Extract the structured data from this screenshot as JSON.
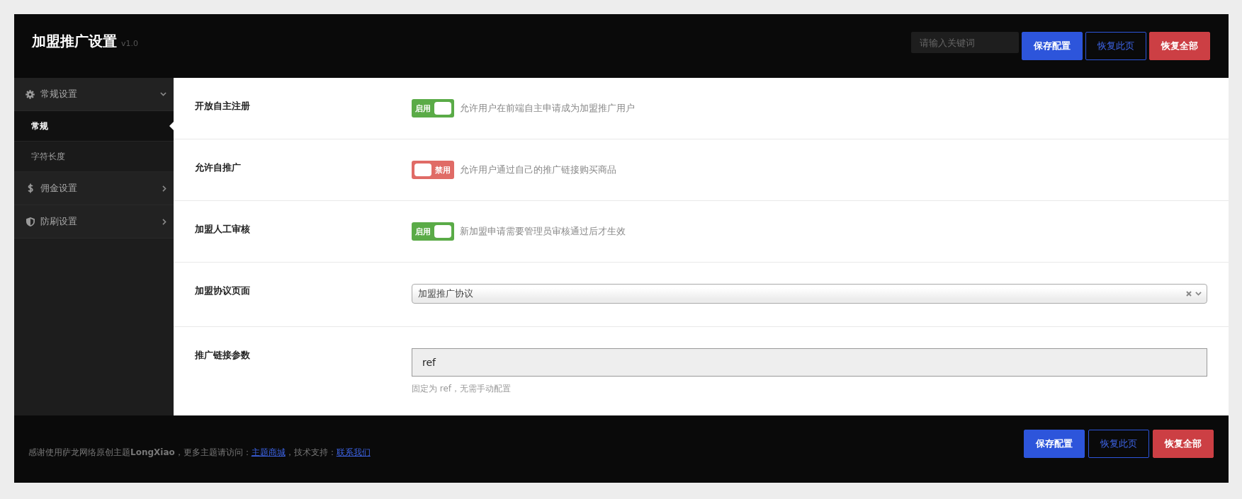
{
  "header": {
    "title": "加盟推广设置",
    "version": "v1.0",
    "search": {
      "placeholder": "请输入关键词"
    },
    "buttons": [
      {
        "label": "保存配置",
        "kind": "primary"
      },
      {
        "label": "恢复此页",
        "kind": "outline"
      },
      {
        "label": "恢复全部",
        "kind": "danger"
      }
    ]
  },
  "sidebar": {
    "items": [
      {
        "label": "常规设置",
        "expanded": true,
        "children": [
          {
            "label": "常规",
            "selected": true
          },
          {
            "label": "字符长度",
            "selected": false
          }
        ]
      },
      {
        "label": "佣金设置",
        "expanded": false
      },
      {
        "label": "防刷设置",
        "expanded": false
      }
    ]
  },
  "settings": {
    "rows": [
      {
        "kind": "switch",
        "label": "开放自主注册",
        "on": true,
        "switch_text": "启用",
        "description": "允许用户在前端自主申请成为加盟推广用户"
      },
      {
        "kind": "switch",
        "label": "允许自推广",
        "on": false,
        "switch_text": "禁用",
        "description": "允许用户通过自己的推广链接购买商品"
      },
      {
        "kind": "switch",
        "label": "加盟人工审核",
        "on": true,
        "switch_text": "启用",
        "description": "新加盟申请需要管理员审核通过后才生效"
      },
      {
        "kind": "select",
        "label": "加盟协议页面",
        "value": "加盟推广协议"
      },
      {
        "kind": "text",
        "label": "推广链接参数",
        "value": "ref",
        "disabled": true,
        "help": "固定为 ref，无需手动配置"
      }
    ]
  },
  "footer": {
    "credit": [
      {
        "kind": "text",
        "text": "感谢使用萨龙网络原创主题**LongXiao**，更多主题请访问："
      },
      {
        "kind": "link",
        "text": "主题商城"
      },
      {
        "kind": "text",
        "text": "，技术支持："
      },
      {
        "kind": "link",
        "text": "联系我们"
      }
    ],
    "buttons": [
      {
        "label": "保存配置",
        "kind": "primary"
      },
      {
        "label": "恢复此页",
        "kind": "outline"
      },
      {
        "label": "恢复全部",
        "kind": "danger"
      }
    ]
  }
}
